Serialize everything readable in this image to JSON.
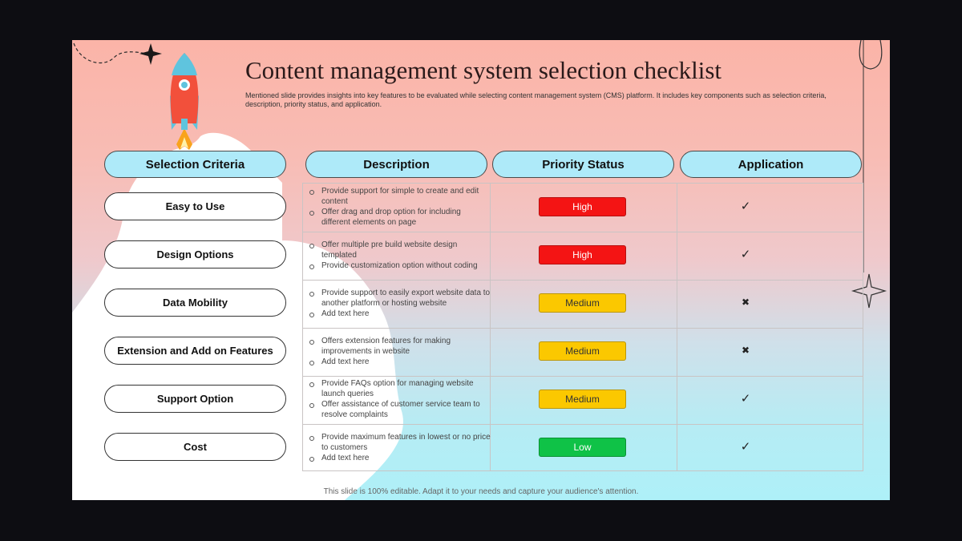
{
  "title": "Content management system selection checklist",
  "subtitle": "Mentioned slide provides insights into key features to be evaluated while selecting content management system (CMS) platform. It includes key components such as selection criteria, description, priority status, and application.",
  "footer": "This slide is 100% editable. Adapt it to your needs and capture your audience's attention.",
  "headers": {
    "criteria": "Selection Criteria",
    "description": "Description",
    "priority": "Priority Status",
    "application": "Application"
  },
  "colors": {
    "high": "#f41414",
    "medium": "#fbc800",
    "low": "#0fc247",
    "header_fill": "#aeeaf9"
  },
  "rows": [
    {
      "criteria": "Easy to Use",
      "description": [
        "Provide  support for simple to create and edit content",
        "Offer drag and drop option for including different  elements  on page"
      ],
      "priority": "High",
      "priority_level": "high",
      "application": "✓",
      "application_icon": "check-icon"
    },
    {
      "criteria": "Design Options",
      "description": [
        "Offer  multiple  pre build  website  design templated",
        "Provide  customization option  without coding"
      ],
      "priority": "High",
      "priority_level": "high",
      "application": "✓",
      "application_icon": "check-icon"
    },
    {
      "criteria": "Data Mobility",
      "description": [
        "Provide  support to easily  export website data to another platform  or hosting website",
        "Add text here"
      ],
      "priority": "Medium",
      "priority_level": "medium",
      "application": "✖",
      "application_icon": "cross-icon"
    },
    {
      "criteria": "Extension and Add on Features",
      "description": [
        "Offers  extension features  for making improvements  in website",
        "Add text here"
      ],
      "priority": "Medium",
      "priority_level": "medium",
      "application": "✖",
      "application_icon": "cross-icon"
    },
    {
      "criteria": "Support Option",
      "description": [
        "Provide  FAQs option  for managing  website launch  queries",
        "Offer  assistance of customer service  team to resolve  complaints"
      ],
      "priority": "Medium",
      "priority_level": "medium",
      "application": "✓",
      "application_icon": "check-icon"
    },
    {
      "criteria": "Cost",
      "description": [
        "Provide  maximum features  in lowest or no price to customers",
        "Add text here"
      ],
      "priority": "Low",
      "priority_level": "low",
      "application": "✓",
      "application_icon": "check-icon"
    }
  ]
}
